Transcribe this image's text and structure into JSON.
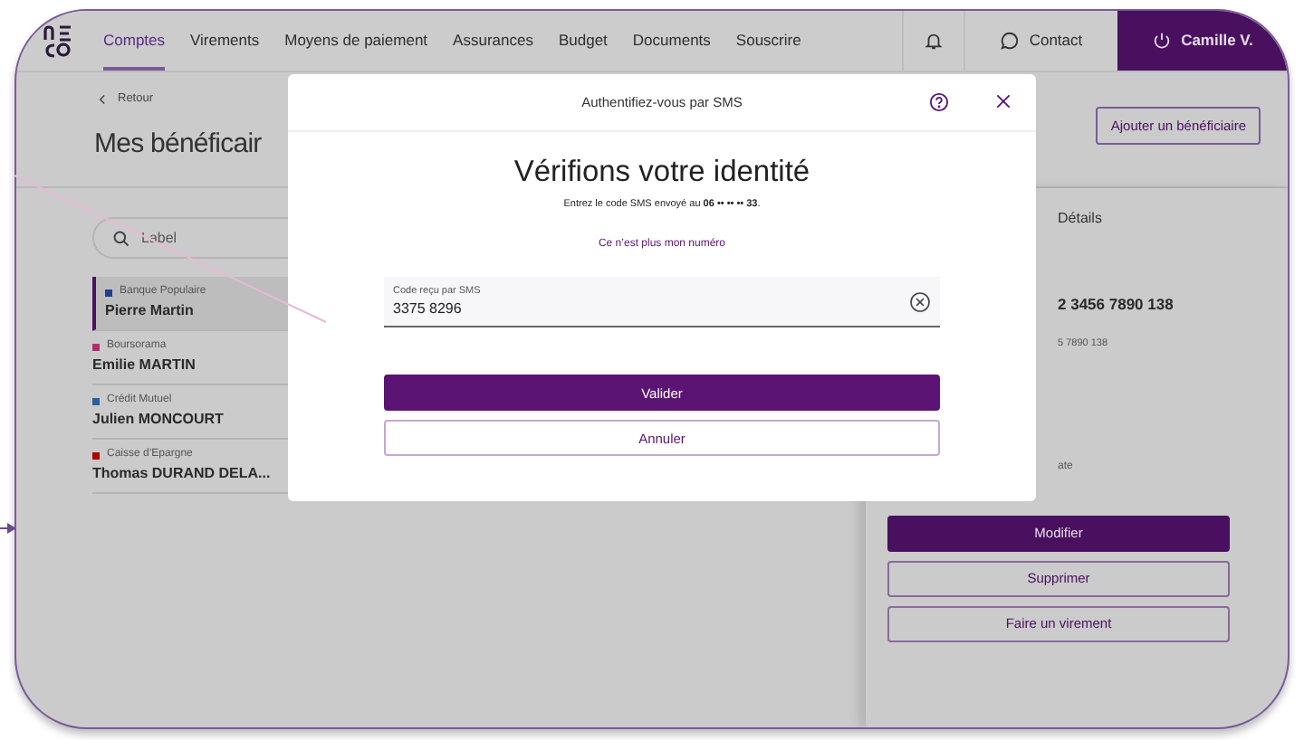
{
  "nav": {
    "tabs": [
      {
        "label": "Comptes",
        "selected": true
      },
      {
        "label": "Virements",
        "selected": false
      },
      {
        "label": "Moyens de paiement",
        "selected": false
      },
      {
        "label": "Assurances",
        "selected": false
      },
      {
        "label": "Budget",
        "selected": false
      },
      {
        "label": "Documents",
        "selected": false
      },
      {
        "label": "Souscrire",
        "selected": false
      }
    ],
    "contact": "Contact",
    "user": "Camille V."
  },
  "page": {
    "back": "Retour",
    "title": "Mes bénéficair",
    "add_button": "Ajouter un bénéficiaire"
  },
  "search": {
    "placeholder": "Label"
  },
  "beneficiaries": [
    {
      "bank": "Banque Populaire",
      "name": "Pierre Martin",
      "color": "#1f3f8f",
      "selected": true
    },
    {
      "bank": "Boursorama",
      "name": "Emilie MARTIN",
      "color": "#b0306a",
      "selected": false
    },
    {
      "bank": "Crédit Mutuel",
      "name": "Julien MONCOURT",
      "color": "#2a5fa0",
      "selected": false
    },
    {
      "bank": "Caisse d’Epargne",
      "name": "Thomas DURAND DELA...",
      "color": "#b00000",
      "selected": false
    }
  ],
  "details": {
    "heading": "Détails",
    "iban": "2 3456 7890 138",
    "sub": "5 7890 138",
    "note": "ate",
    "buttons": [
      {
        "label": "Modifier",
        "kind": "primary"
      },
      {
        "label": "Supprimer",
        "kind": "secondary"
      },
      {
        "label": "Faire un virement",
        "kind": "secondary"
      }
    ]
  },
  "modal": {
    "title": "Authentifiez-vous par SMS",
    "heading": "Vérifions votre identité",
    "instruction": "Entrez le code SMS envoyé au **06 •• •• •• 33**.",
    "link": "Ce n’est plus mon numéro",
    "field": {
      "label": "Code reçu par SMS",
      "value": "3375 8296"
    },
    "buttons": [
      {
        "label": "Valider",
        "kind": "primary"
      },
      {
        "label": "Annuler",
        "kind": "secondary"
      }
    ]
  }
}
